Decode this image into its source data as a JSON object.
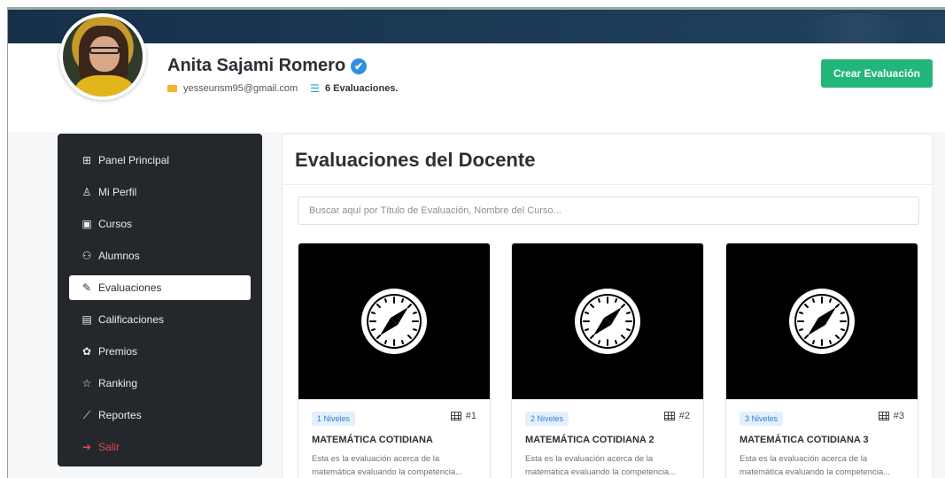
{
  "profile": {
    "name": "Anita Sajami Romero",
    "verified_mark": "✔",
    "email": "yesseunsm95@gmail.com",
    "evaluations_count": "6 Evaluaciones."
  },
  "header": {
    "create_label": "Crear Evaluación"
  },
  "sidebar": {
    "items": [
      {
        "label": "Panel Principal",
        "icon": "dashboard-icon",
        "glyph": "⊞"
      },
      {
        "label": "Mi Perfil",
        "icon": "user-icon",
        "glyph": "♙"
      },
      {
        "label": "Cursos",
        "icon": "book-icon",
        "glyph": "▣"
      },
      {
        "label": "Alumnos",
        "icon": "group-icon",
        "glyph": "⚇"
      },
      {
        "label": "Evaluaciones",
        "icon": "edit-icon",
        "glyph": "✎"
      },
      {
        "label": "Calificaciones",
        "icon": "id-card-icon",
        "glyph": "▤"
      },
      {
        "label": "Premios",
        "icon": "award-icon",
        "glyph": "✿"
      },
      {
        "label": "Ranking",
        "icon": "star-icon",
        "glyph": "☆"
      },
      {
        "label": "Reportes",
        "icon": "chart-line-icon",
        "glyph": "⟋"
      },
      {
        "label": "Salir",
        "icon": "logout-icon",
        "glyph": "➔"
      }
    ],
    "active": "Evaluaciones"
  },
  "main": {
    "title": "Evaluaciones del Docente",
    "search_placeholder": "Buscar aquí por Título de Evaluación, Nombre del Curso...",
    "cards": [
      {
        "levels": "1 Niveles",
        "number": "#1",
        "title": "MATEMÁTICA COTIDIANA",
        "description": "Esta es la evaluación acerca de la matemática evaluando la competencia..."
      },
      {
        "levels": "2 Niveles",
        "number": "#2",
        "title": "MATEMÁTICA COTIDIANA 2",
        "description": "Esta es la evaluación acerca de la matemática evaluando la competencia..."
      },
      {
        "levels": "3 Niveles",
        "number": "#3",
        "title": "MATEMÁTICA COTIDIANA 3",
        "description": "Esta es la evaluación acerca de la matemática evaluando la competencia..."
      }
    ]
  },
  "colors": {
    "accent_green": "#22b67a",
    "sidebar_bg": "#24282d",
    "banner_bg": "#1c3a57",
    "logout_red": "#e5484d",
    "badge_blue": "#2f7fd6"
  }
}
